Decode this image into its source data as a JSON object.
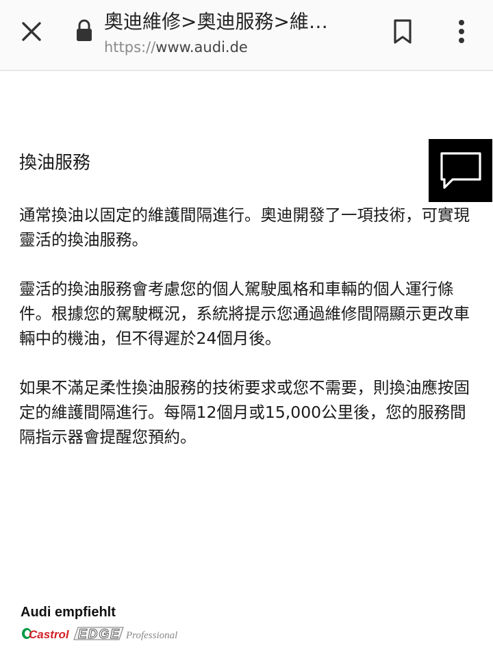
{
  "browser": {
    "page_title": "奧迪維修>奧迪服務>維…",
    "url_scheme": "https://",
    "url_host": "www.audi.de"
  },
  "icons": {
    "close": "close-icon",
    "lock": "lock-icon",
    "bookmark": "bookmark-icon",
    "menu": "more-vert-icon",
    "chat": "chat-icon"
  },
  "article": {
    "heading": "換油服務",
    "paragraphs": [
      "通常換油以固定的維護間隔進行。奧迪開發了一項技術，可實現靈活的換油服務。",
      "靈活的換油服務會考慮您的個人駕駛風格和車輛的個人運行條件。根據您的駕駛概況，系統將提示您通過維修間隔顯示更改車輛中的機油，但不得遲於24個月後。",
      "如果不滿足柔性換油服務的技術要求或您不需要，則換油應按固定的維護間隔進行。每隔12個月或15,000公里後，您的服務間隔指示器會提醒您預約。"
    ]
  },
  "footer": {
    "recommend_label": "Audi empfiehlt",
    "logo_brand": "Castrol",
    "logo_product": "EDGE",
    "logo_tag": "Professional"
  },
  "colors": {
    "chat_bg": "#000000",
    "castrol_red": "#d41f26",
    "castrol_green": "#009a44"
  }
}
